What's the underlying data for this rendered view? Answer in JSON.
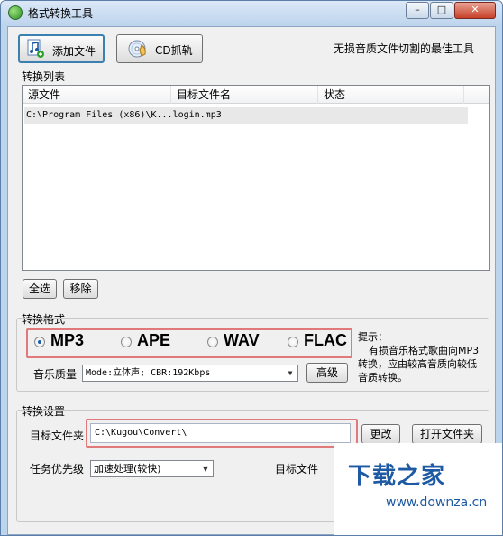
{
  "window": {
    "title": "格式转换工具"
  },
  "title_controls": {
    "minimize": "–",
    "maximize": "□",
    "close": "✕"
  },
  "toolbar": {
    "add_file_label": "添加文件",
    "cd_rip_label": "CD抓轨",
    "slogan": "无损音质文件切割的最佳工具",
    "icons": [
      "music-note-icon",
      "cd-disc-icon"
    ]
  },
  "convert_list": {
    "group_label": "转换列表",
    "columns": [
      "源文件",
      "目标文件名",
      "状态"
    ],
    "rows": [
      {
        "source": "C:\\Program Files (x86)\\K...login.mp3",
        "target": "",
        "status": ""
      }
    ],
    "select_all_label": "全选",
    "remove_label": "移除"
  },
  "format": {
    "group_label": "转换格式",
    "options": [
      {
        "label": "MP3",
        "selected": true
      },
      {
        "label": "APE",
        "selected": false
      },
      {
        "label": "WAV",
        "selected": false
      },
      {
        "label": "FLAC",
        "selected": false
      }
    ],
    "quality_label": "音乐质量",
    "quality_value": "Mode:立体声; CBR:192Kbps",
    "advanced_label": "高级",
    "hint_title": "提示：",
    "hint_lines": [
      "有损音乐格式歌曲向MP3",
      "转换，应由较高音质向较低",
      "音质转换。"
    ]
  },
  "settings": {
    "group_label": "转换设置",
    "target_folder_label": "目标文件夹",
    "target_folder_value": "C:\\Kugou\\Convert\\",
    "change_label": "更改",
    "open_folder_label": "打开文件夹",
    "priority_label": "任务优先级",
    "priority_value": "加速处理(较快)",
    "target_file_label": "目标文件"
  },
  "watermark": {
    "text": "下载之家",
    "url": "www.downza.cn"
  },
  "colors": {
    "accent_blue": "#1d5aa3",
    "highlight_red": "#e07a7a",
    "window_frame": "#bcd4ec"
  }
}
